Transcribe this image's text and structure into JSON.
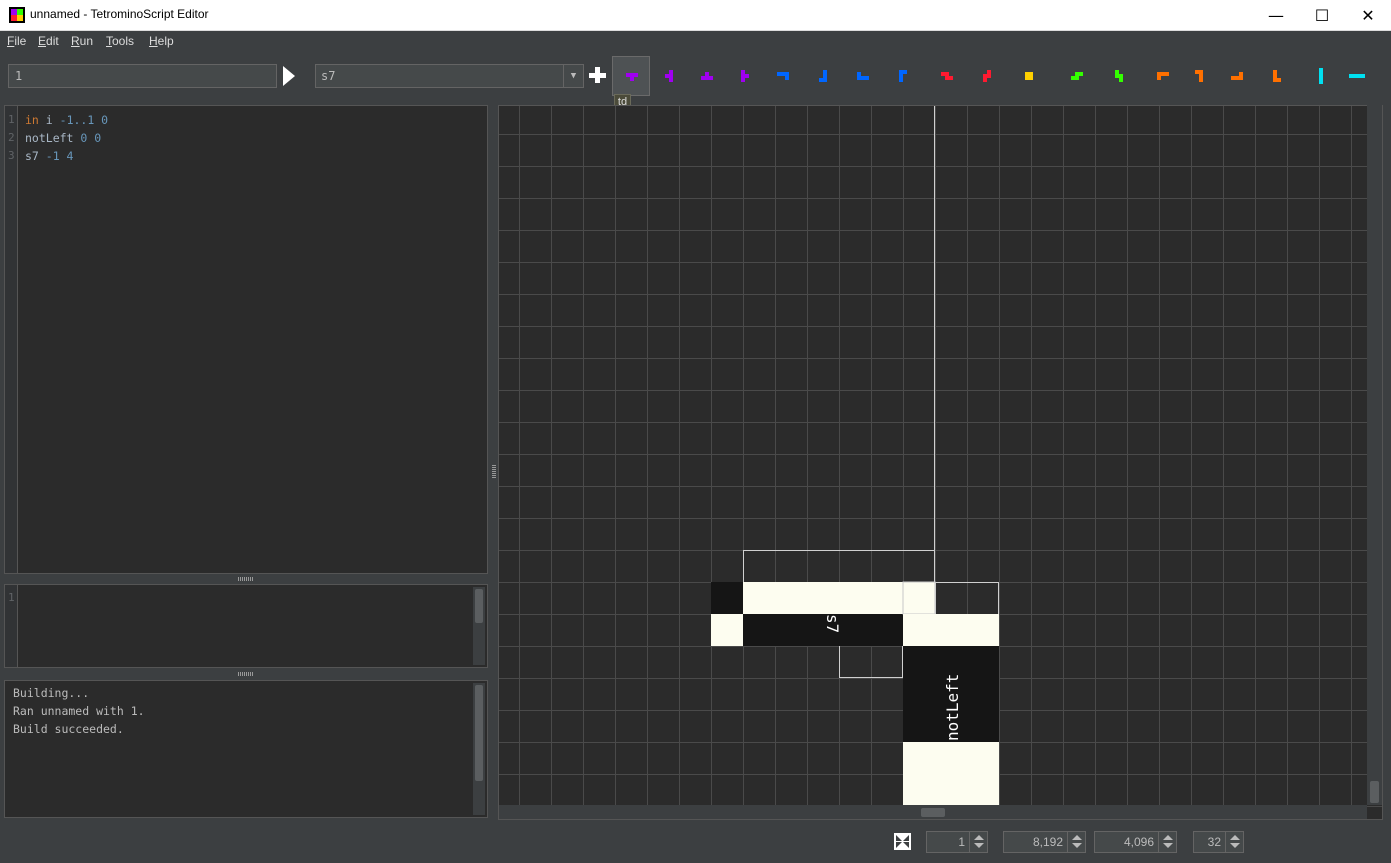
{
  "window": {
    "title": "unnamed - TetrominoScript Editor",
    "controls": {
      "minimize": "—",
      "maximize": "☐",
      "close": "✕"
    }
  },
  "menu": [
    "File",
    "Edit",
    "Run",
    "Tools",
    "Help"
  ],
  "toolbar": {
    "arguments_value": "1",
    "selected_tetromino": "s7",
    "tooltip": "td",
    "palette": [
      {
        "name": "td",
        "color": "#a000f0"
      },
      {
        "name": "tl",
        "color": "#a000f0"
      },
      {
        "name": "tu",
        "color": "#a000f0"
      },
      {
        "name": "tr",
        "color": "#a000f0"
      },
      {
        "name": "jd",
        "color": "#0066ff"
      },
      {
        "name": "jl",
        "color": "#0066ff"
      },
      {
        "name": "ju",
        "color": "#0066ff"
      },
      {
        "name": "jr",
        "color": "#0066ff"
      },
      {
        "name": "zh",
        "color": "#ff1a30"
      },
      {
        "name": "zv",
        "color": "#ff1a30"
      },
      {
        "name": "o",
        "color": "#ffd000"
      },
      {
        "name": "sh",
        "color": "#33ff00"
      },
      {
        "name": "sv",
        "color": "#33ff00"
      },
      {
        "name": "ld",
        "color": "#ff7000"
      },
      {
        "name": "ll",
        "color": "#ff7000"
      },
      {
        "name": "lu",
        "color": "#ff7000"
      },
      {
        "name": "lr",
        "color": "#ff7000"
      },
      {
        "name": "iv",
        "color": "#00e0f0"
      },
      {
        "name": "ih",
        "color": "#00e0f0"
      }
    ]
  },
  "editor": {
    "line_numbers": [
      "1",
      "2",
      "3"
    ],
    "lines": [
      [
        {
          "t": "in",
          "c": "kw"
        },
        {
          "t": " i ",
          "c": ""
        },
        {
          "t": "-1..1 0",
          "c": "num"
        }
      ],
      [
        {
          "t": "notLeft ",
          "c": ""
        },
        {
          "t": "0 0",
          "c": "num"
        }
      ],
      [
        {
          "t": "s7 ",
          "c": ""
        },
        {
          "t": "-1 4",
          "c": "num"
        }
      ]
    ]
  },
  "args_pane": {
    "line_numbers": [
      "1"
    ]
  },
  "console": {
    "lines": [
      "Building...",
      "Ran unnamed with 1.",
      "Build succeeded."
    ]
  },
  "canvas": {
    "labels": {
      "s7": "s7",
      "notLeft": "notLeft"
    }
  },
  "status": {
    "scale": "1",
    "width": "8,192",
    "height": "4,096",
    "cell_size": "32"
  }
}
